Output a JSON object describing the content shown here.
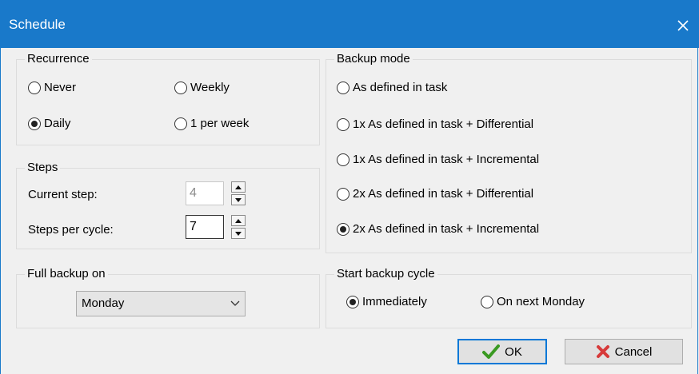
{
  "window": {
    "title": "Schedule",
    "close_icon": "close-icon"
  },
  "recurrence": {
    "legend": "Recurrence",
    "options": [
      {
        "label": "Never",
        "selected": false
      },
      {
        "label": "Weekly",
        "selected": false
      },
      {
        "label": "Daily",
        "selected": true
      },
      {
        "label": "1 per week",
        "selected": false
      }
    ]
  },
  "steps": {
    "legend": "Steps",
    "current_step_label": "Current step:",
    "current_step_value": "4",
    "steps_per_cycle_label": "Steps per cycle:",
    "steps_per_cycle_value": "7"
  },
  "full_backup": {
    "legend": "Full backup on",
    "selected": "Monday"
  },
  "backup_mode": {
    "legend": "Backup mode",
    "options": [
      {
        "label": "As defined in task",
        "selected": false
      },
      {
        "label": "1x As defined in task + Differential",
        "selected": false
      },
      {
        "label": "1x As defined in task + Incremental",
        "selected": false
      },
      {
        "label": "2x As defined in task + Differential",
        "selected": false
      },
      {
        "label": "2x As defined in task + Incremental",
        "selected": true
      }
    ]
  },
  "start_cycle": {
    "legend": "Start backup cycle",
    "options": [
      {
        "label": "Immediately",
        "selected": true
      },
      {
        "label": "On next Monday",
        "selected": false
      }
    ]
  },
  "buttons": {
    "ok_label": "OK",
    "cancel_label": "Cancel"
  },
  "colors": {
    "titlebar": "#1979ca",
    "ok_check": "#3a9a22",
    "cancel_x": "#d73a3a"
  }
}
